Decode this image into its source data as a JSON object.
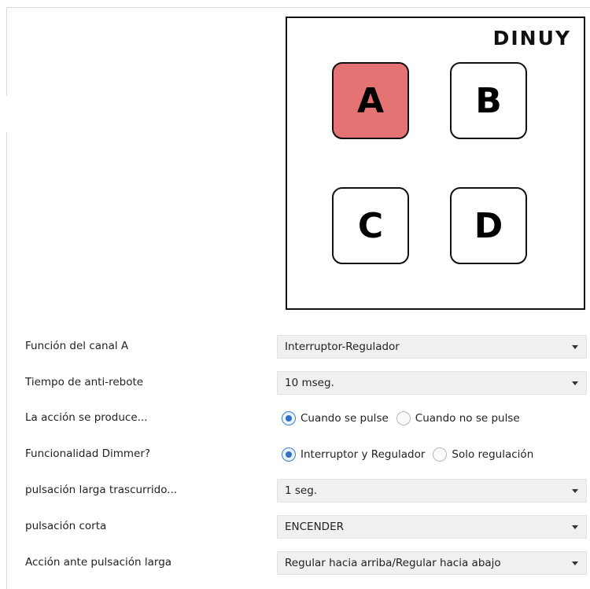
{
  "device": {
    "brand": "DINUY",
    "keys": [
      {
        "label": "A",
        "active": true
      },
      {
        "label": "B",
        "active": false
      },
      {
        "label": "C",
        "active": false
      },
      {
        "label": "D",
        "active": false
      }
    ],
    "active_color": "#e57373"
  },
  "params": {
    "funcion": {
      "label": "Función del canal A",
      "value": "Interruptor-Regulador"
    },
    "antirebote": {
      "label": "Tiempo de anti-rebote",
      "value": "10 mseg."
    },
    "accion": {
      "label": "La acción se produce...",
      "option1": "Cuando se pulse",
      "option2": "Cuando no se pulse",
      "selected": "Cuando se pulse"
    },
    "dimmer": {
      "label": "Funcionalidad Dimmer?",
      "option1": "Interruptor y Regulador",
      "option2": "Solo regulación",
      "selected": "Interruptor y Regulador"
    },
    "larga_trascurrido": {
      "label": "pulsación larga trascurrido...",
      "value": "1 seg."
    },
    "corta": {
      "label": "pulsación corta",
      "value": "ENCENDER"
    },
    "accion_larga": {
      "label": "Acción ante pulsación larga",
      "value": "Regular hacia arriba/Regular hacia abajo"
    }
  }
}
